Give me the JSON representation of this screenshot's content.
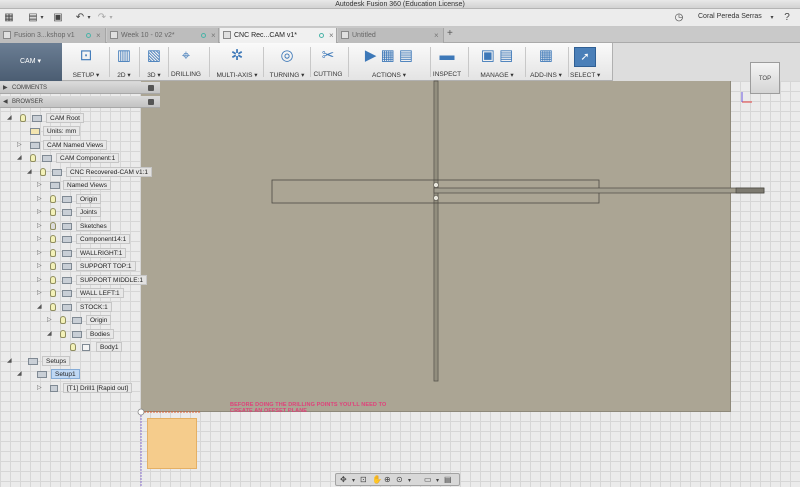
{
  "window": {
    "title": "Autodesk Fusion 360 (Education License)"
  },
  "quick_access": {
    "user_name": "Coral Pereda Serras"
  },
  "tabs": [
    {
      "label": "Fusion 3...kshop v1",
      "active": false
    },
    {
      "label": "Week 10 - 02 v2*",
      "active": false
    },
    {
      "label": "CNC Rec...CAM v1*",
      "active": true
    },
    {
      "label": "Untitled",
      "active": false
    }
  ],
  "ribbon": {
    "workspace": "CAM",
    "groups": [
      "SETUP",
      "2D",
      "3D",
      "DRILLING",
      "MULTI-AXIS",
      "TURNING",
      "CUTTING",
      "ACTIONS",
      "INSPECT",
      "MANAGE",
      "ADD-INS",
      "SELECT"
    ]
  },
  "panels": {
    "comments": "COMMENTS",
    "browser": "BROWSER"
  },
  "tree": [
    {
      "label": "CAM Root"
    },
    {
      "label": "Units: mm"
    },
    {
      "label": "CAM Named Views"
    },
    {
      "label": "CAM Component:1"
    },
    {
      "label": "CNC Recovered-CAM v1:1"
    },
    {
      "label": "Named Views"
    },
    {
      "label": "Origin"
    },
    {
      "label": "Joints"
    },
    {
      "label": "Sketches"
    },
    {
      "label": "Component14:1"
    },
    {
      "label": "WALLRIGHT:1"
    },
    {
      "label": "SUPPORT TOP:1"
    },
    {
      "label": "SUPPORT MIDDLE:1"
    },
    {
      "label": "WALL LEFT:1"
    },
    {
      "label": "STOCK:1"
    },
    {
      "label": "Origin"
    },
    {
      "label": "Bodies"
    },
    {
      "label": "Body1"
    },
    {
      "label": "Setups"
    },
    {
      "label": "Setup1"
    },
    {
      "label": "[T1] Drill1 [Rapid out]"
    }
  ],
  "viewport": {
    "annotation": "BEFORE DOING THE DRILLING POINTS YOU'LL NEED TO CREATE AN OFFSET PLANE",
    "view_cube_label": "TOP"
  },
  "colors": {
    "stock_face": "#aba594",
    "annotation": "#e0407a",
    "workspace_button": "#4b5d72",
    "selection": "#bfd8f4"
  },
  "icons": {
    "grid_menu": "apps-grid-icon",
    "file": "file-icon",
    "save": "save-icon",
    "undo": "undo-icon",
    "redo": "redo-icon",
    "clock": "clock-icon",
    "help": "help-icon"
  }
}
